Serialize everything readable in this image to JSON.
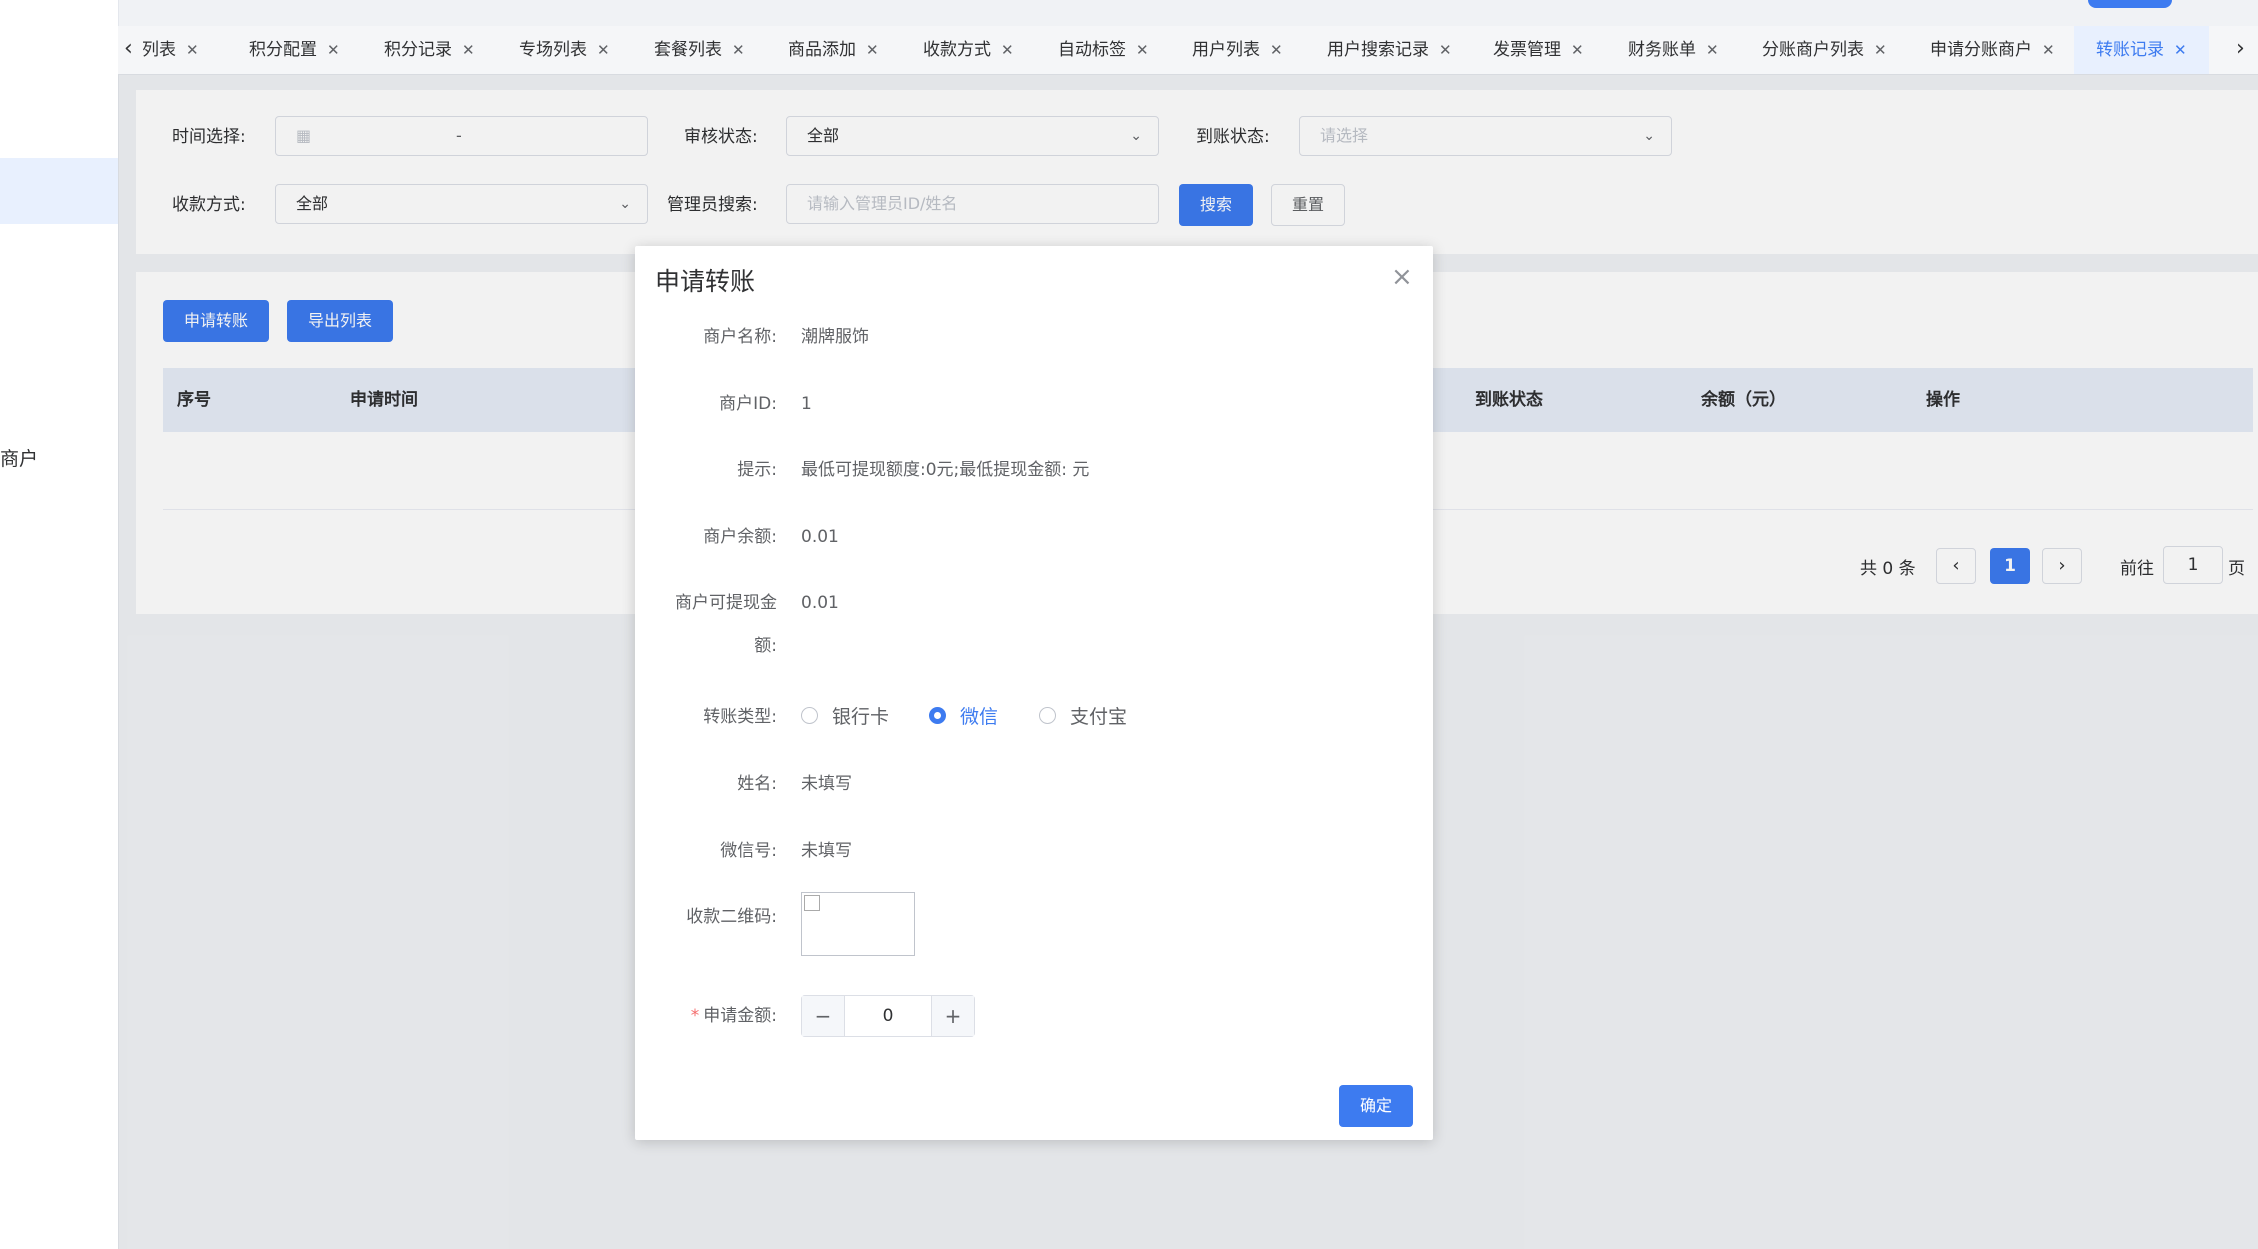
{
  "tabs": [
    {
      "label": "列表",
      "active": false
    },
    {
      "label": "积分配置",
      "active": false
    },
    {
      "label": "积分记录",
      "active": false
    },
    {
      "label": "专场列表",
      "active": false
    },
    {
      "label": "套餐列表",
      "active": false
    },
    {
      "label": "商品添加",
      "active": false
    },
    {
      "label": "收款方式",
      "active": false
    },
    {
      "label": "自动标签",
      "active": false
    },
    {
      "label": "用户列表",
      "active": false
    },
    {
      "label": "用户搜索记录",
      "active": false
    },
    {
      "label": "发票管理",
      "active": false
    },
    {
      "label": "财务账单",
      "active": false
    },
    {
      "label": "分账商户列表",
      "active": false
    },
    {
      "label": "申请分账商户",
      "active": false
    },
    {
      "label": "转账记录",
      "active": true
    }
  ],
  "sidebar": {
    "partial_label": "商户"
  },
  "filters": {
    "time_label": "时间选择:",
    "time_separator": "-",
    "audit_label": "审核状态:",
    "audit_value": "全部",
    "arrival_label": "到账状态:",
    "arrival_placeholder": "请选择",
    "payment_label": "收款方式:",
    "payment_value": "全部",
    "admin_label": "管理员搜索:",
    "admin_placeholder": "请输入管理员ID/姓名",
    "search_button": "搜索",
    "reset_button": "重置"
  },
  "actions": {
    "apply_button": "申请转账",
    "export_button": "导出列表"
  },
  "table": {
    "columns": [
      "序号",
      "申请时间",
      "到账状态",
      "余额（元）",
      "操作"
    ]
  },
  "pagination": {
    "total_text": "共 0 条",
    "current_page": "1",
    "goto_label": "前往",
    "goto_value": "1",
    "page_unit": "页"
  },
  "dialog": {
    "title": "申请转账",
    "merchant_name_label": "商户名称:",
    "merchant_name_value": "潮牌服饰",
    "merchant_id_label": "商户ID:",
    "merchant_id_value": "1",
    "tip_label": "提示:",
    "tip_value": "最低可提现额度:0元;最低提现金额: 元",
    "balance_label": "商户余额:",
    "balance_value": "0.01",
    "withdrawable_label_line1": "商户可提现金",
    "withdrawable_label_line2": "额:",
    "withdrawable_value": "0.01",
    "transfer_type_label": "转账类型:",
    "transfer_types": [
      "银行卡",
      "微信",
      "支付宝"
    ],
    "selected_transfer_type": "微信",
    "name_label": "姓名:",
    "name_value": "未填写",
    "wechat_label": "微信号:",
    "wechat_value": "未填写",
    "qr_label": "收款二维码:",
    "amount_label": "申请金额:",
    "amount_value": "0",
    "confirm_button": "确定"
  },
  "colors": {
    "primary": "#3d7bf0",
    "required": "#f56c6c"
  },
  "icons": [
    "calendar-icon",
    "chevron-down-icon",
    "close-icon",
    "chevron-left-icon",
    "chevron-right-icon",
    "minus-icon",
    "plus-icon"
  ]
}
